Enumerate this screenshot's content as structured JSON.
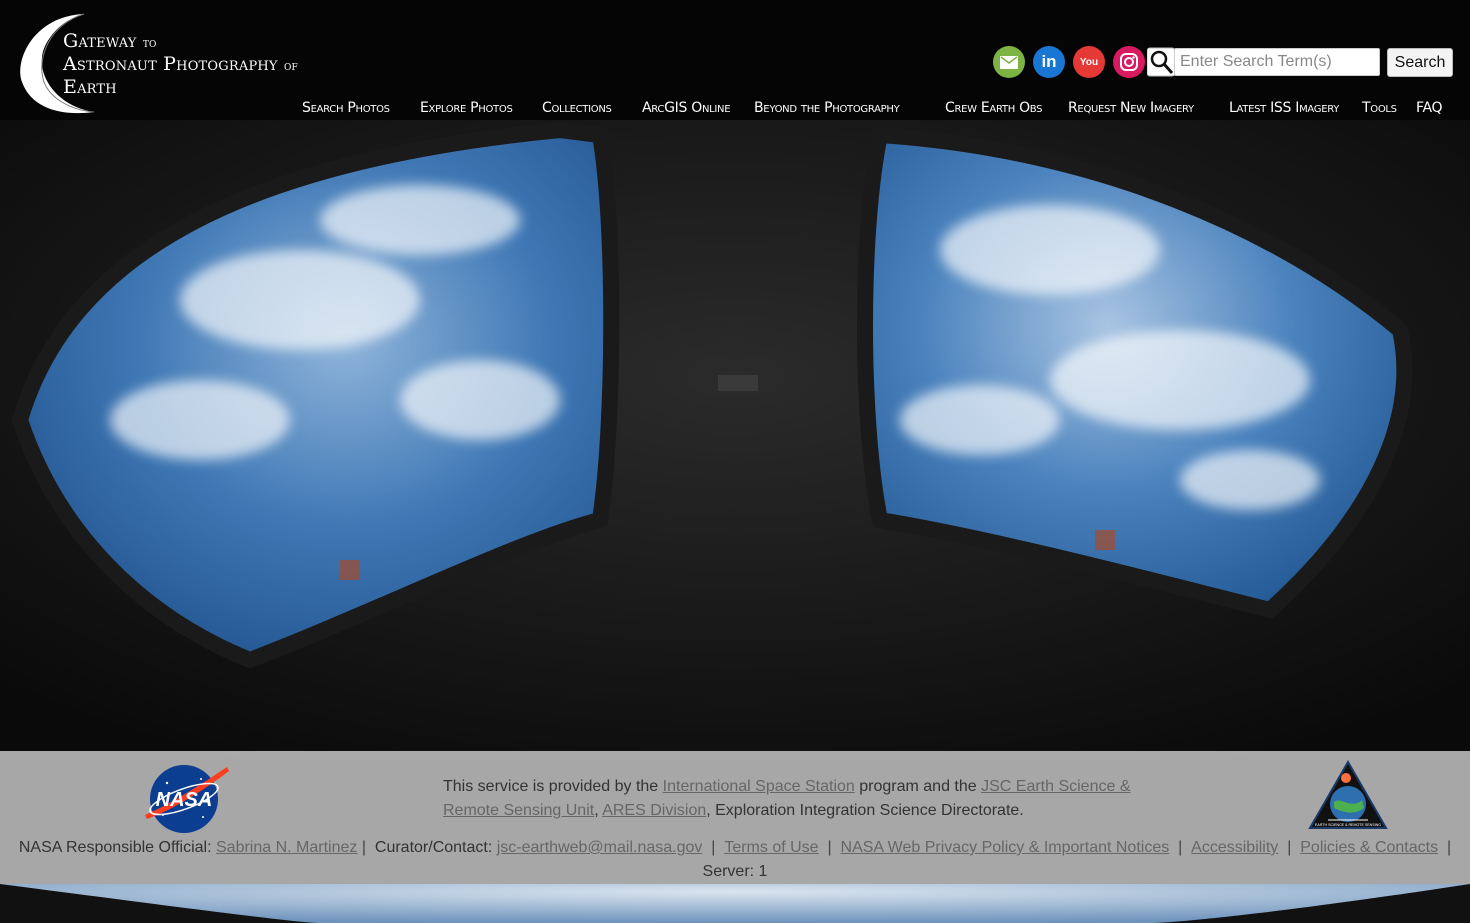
{
  "site": {
    "title_line1_big": "Gateway",
    "title_line1_small": "to",
    "title_line2_big": "Astronaut Photography",
    "title_line2_small": "of",
    "title_line3_big": "Earth"
  },
  "social": [
    {
      "name": "email",
      "icon": "envelope-icon",
      "color": "#7cb342"
    },
    {
      "name": "linkedin",
      "icon": "linkedin-icon",
      "color": "#1976d2",
      "glyph": "in"
    },
    {
      "name": "youtube",
      "icon": "youtube-icon",
      "color": "#e53935",
      "glyph": "You"
    },
    {
      "name": "instagram",
      "icon": "instagram-icon",
      "color": "#d81b60"
    }
  ],
  "search": {
    "placeholder": "Enter Search Term(s)",
    "button_label": "Search"
  },
  "nav": [
    {
      "label": "Search Photos"
    },
    {
      "label": "Explore Photos"
    },
    {
      "label": "Collections"
    },
    {
      "label": "ArcGIS Online"
    },
    {
      "label": "Beyond the Photography"
    },
    {
      "label": "Crew Earth Obs"
    },
    {
      "label": "Request New Imagery"
    },
    {
      "label": "Latest ISS Imagery"
    },
    {
      "label": "Tools"
    },
    {
      "label": "FAQ"
    }
  ],
  "footer": {
    "service_prefix": "This service is provided by the ",
    "iss_link": "International Space Station",
    "service_mid": " program and the ",
    "jsc_link": "JSC Earth Science & Remote Sensing Unit",
    "comma": ", ",
    "ares_link": "ARES Division",
    "service_suffix": ", Exploration Integration Science Directorate.",
    "official_label": "NASA Responsible Official: ",
    "official_name": "Sabrina N. Martinez",
    "curator_label": "Curator/Contact: ",
    "curator_email": "jsc-earthweb@mail.nasa.gov",
    "terms": "Terms of Use",
    "privacy": "NASA Web Privacy Policy & Important Notices",
    "accessibility": "Accessibility",
    "policies": "Policies & Contacts",
    "server": "Server: 1",
    "nasa_logo_text": "NASA",
    "esrs_logo_text": "EARTH SCIENCE & REMOTE SENSING"
  },
  "colors": {
    "nav_text": "#ffffff",
    "footer_bg": "#cccccc",
    "footer_link": "#666666"
  }
}
